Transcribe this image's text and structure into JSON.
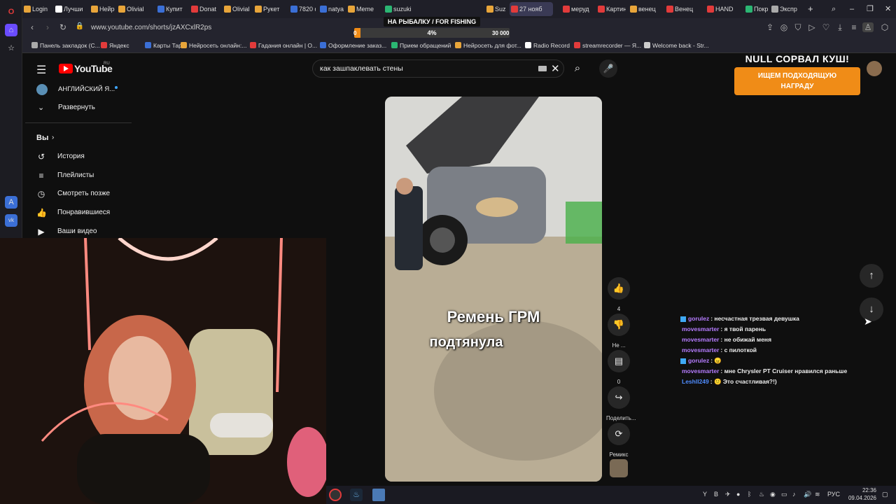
{
  "browser": {
    "tabs": [
      {
        "label": "Login",
        "color": "#e8a53a"
      },
      {
        "label": "Лучши",
        "color": "#ffffff"
      },
      {
        "label": "Нейро",
        "color": "#e8a53a"
      },
      {
        "label": "Olivial",
        "color": "#e8a53a"
      },
      {
        "label": "Купит",
        "color": "#3b6fd6"
      },
      {
        "label": "Donat",
        "color": "#e23b3b"
      },
      {
        "label": "Olivial",
        "color": "#e8a53a"
      },
      {
        "label": "Рукет",
        "color": "#e8a53a"
      },
      {
        "label": "7820 ф",
        "color": "#3b6fd6"
      },
      {
        "label": "natyaz",
        "color": "#3b6fd6"
      },
      {
        "label": "Meme",
        "color": "#e8a53a"
      },
      {
        "label": "suzuki",
        "color": "#2bb673"
      },
      {
        "label": "Suzuki",
        "color": "#e8a53a"
      },
      {
        "label": "27 нояб",
        "color": "#e23b3b"
      },
      {
        "label": "меруд",
        "color": "#e23b3b"
      },
      {
        "label": "Картин",
        "color": "#e23b3b"
      },
      {
        "label": "венец",
        "color": "#e8a53a"
      },
      {
        "label": "Венец",
        "color": "#e23b3b"
      },
      {
        "label": "HAND",
        "color": "#e23b3b"
      },
      {
        "label": "Покра",
        "color": "#2bb673"
      },
      {
        "label": "Экспр",
        "color": "#aaaaaa"
      }
    ],
    "url": "www.youtube.com/shorts/jzAXCxlR2ps",
    "bookmarks": [
      {
        "label": "Панель закладок (С...",
        "color": "#aaaaaa"
      },
      {
        "label": "Яндекс",
        "color": "#e23b3b"
      },
      {
        "label": "Карты Таро",
        "color": "#3b6fd6"
      },
      {
        "label": "Нейросеть онлайн:...",
        "color": "#e8a53a"
      },
      {
        "label": "Гадания онлайн | О...",
        "color": "#e23b3b"
      },
      {
        "label": "Оформление заказ...",
        "color": "#3b6fd6"
      },
      {
        "label": "Прием обращений",
        "color": "#2bb673"
      },
      {
        "label": "Нейросеть для фот...",
        "color": "#e8a53a"
      },
      {
        "label": "Radio Record",
        "color": "#ffffff"
      },
      {
        "label": "streamrecorder — Я...",
        "color": "#e23b3b"
      },
      {
        "label": "Welcome back - Str...",
        "color": "#cccccc"
      }
    ]
  },
  "goal_widget": {
    "title": "НА РЫБАЛКУ / FOR FISHING",
    "percent_label": "4%",
    "progress": 0.04,
    "min_label": "0",
    "max_label": "30 000"
  },
  "youtube": {
    "logo_text": "YouTube",
    "region": "RU",
    "channel_name": "АНГЛИЙСКИЙ Я...",
    "expand_label": "Развернуть",
    "you_label": "Вы",
    "menu": [
      {
        "label": "История",
        "icon": "history-icon"
      },
      {
        "label": "Плейлисты",
        "icon": "playlists-icon"
      },
      {
        "label": "Смотреть позже",
        "icon": "watch-later-icon"
      },
      {
        "label": "Понравившиеся",
        "icon": "liked-icon"
      },
      {
        "label": "Ваши видео",
        "icon": "your-videos-icon"
      }
    ],
    "search_query": "как зашпаклевать стены",
    "video_caption_line1": "Ремень  ГРМ",
    "video_caption_line2": "подтянула",
    "actions": {
      "like_count": "4",
      "dislike_label": "Не ...",
      "comments_count": "0",
      "share_label": "Поделить...",
      "remix_label": "Ремикс"
    }
  },
  "overlay": {
    "title": "NULL СОРВАЛ КУШ!",
    "badge_line1": "ИЩЕМ ПОДХОДЯЩУЮ",
    "badge_line2": "НАГРАДУ"
  },
  "chat": [
    {
      "user": "gorulez",
      "user_color": "#b57cff",
      "badge": true,
      "message": ": несчастная трезвая девушка"
    },
    {
      "user": "movesmarter",
      "user_color": "#b57cff",
      "badge": false,
      "message": ": я твой парень"
    },
    {
      "user": "movesmarter",
      "user_color": "#b57cff",
      "badge": false,
      "message": ": не обижай меня"
    },
    {
      "user": "movesmarter",
      "user_color": "#b57cff",
      "badge": false,
      "message": ": с пилоткой"
    },
    {
      "user": "gorulez",
      "user_color": "#b57cff",
      "badge": true,
      "message": ": 😠"
    },
    {
      "user": "movesmarter",
      "user_color": "#b57cff",
      "badge": false,
      "message": ": мне Chrysler PT Cruiser нравился раньше"
    },
    {
      "user": "Leshll249",
      "user_color": "#4f8cff",
      "badge": false,
      "message": ": 🙂 Это счастливая?!)"
    }
  ],
  "taskbar": {
    "lang": "РУС",
    "time": "22:36",
    "date": "09.04.2026"
  }
}
